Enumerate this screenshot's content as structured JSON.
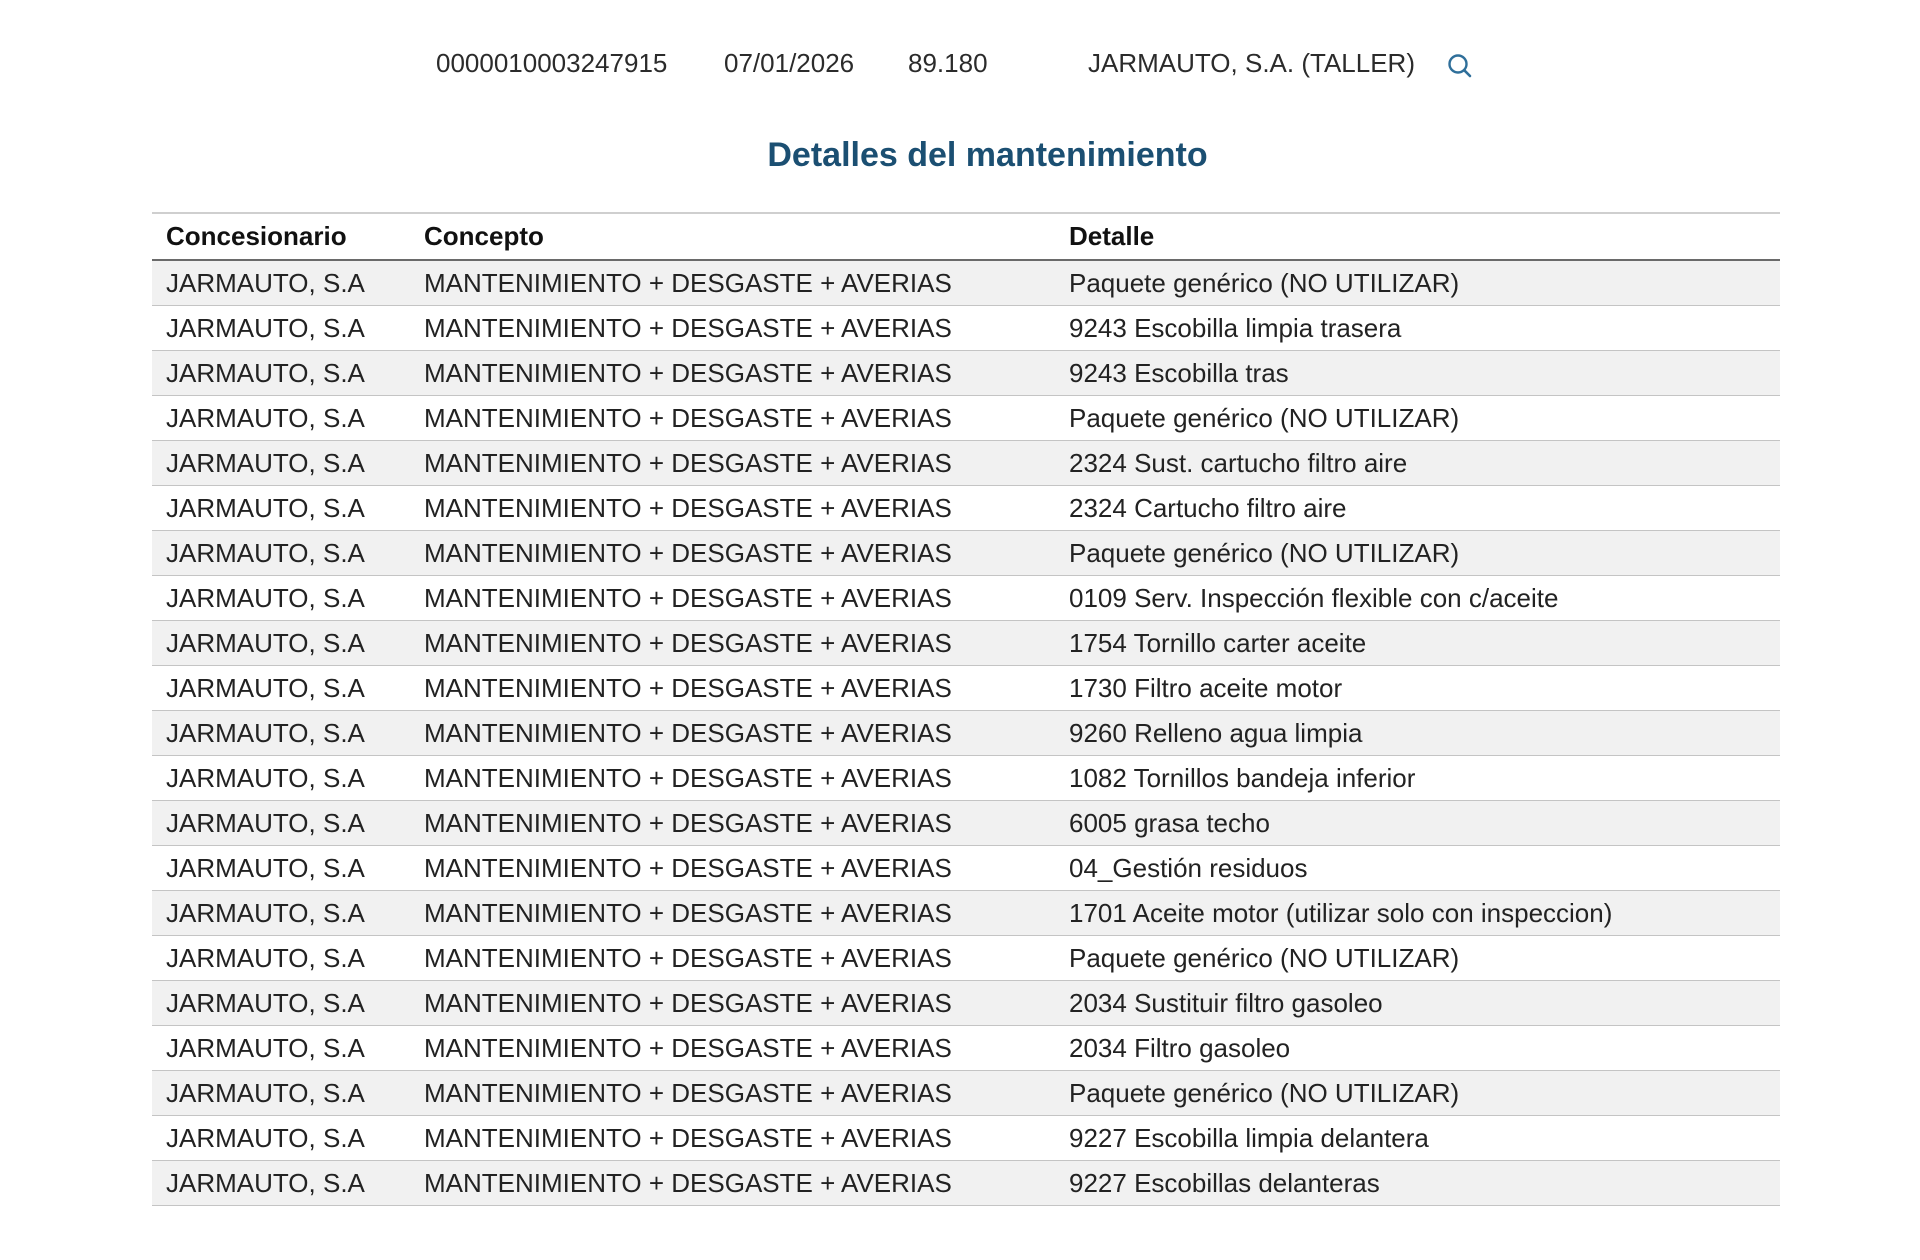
{
  "summary": {
    "id": "0000010003247915",
    "date": "07/01/2026",
    "km": "89.180",
    "dealer": "JARMAUTO, S.A. (TALLER)",
    "search_icon": "search-icon"
  },
  "title": "Detalles del mantenimiento",
  "table": {
    "headers": [
      "Concesionario",
      "Concepto",
      "Detalle"
    ],
    "rows": [
      [
        "JARMAUTO, S.A",
        "MANTENIMIENTO + DESGASTE + AVERIAS",
        "Paquete genérico (NO UTILIZAR)"
      ],
      [
        "JARMAUTO, S.A",
        "MANTENIMIENTO + DESGASTE + AVERIAS",
        "9243 Escobilla limpia trasera"
      ],
      [
        "JARMAUTO, S.A",
        "MANTENIMIENTO + DESGASTE + AVERIAS",
        "9243 Escobilla tras"
      ],
      [
        "JARMAUTO, S.A",
        "MANTENIMIENTO + DESGASTE + AVERIAS",
        "Paquete genérico (NO UTILIZAR)"
      ],
      [
        "JARMAUTO, S.A",
        "MANTENIMIENTO + DESGASTE + AVERIAS",
        "2324 Sust. cartucho filtro aire"
      ],
      [
        "JARMAUTO, S.A",
        "MANTENIMIENTO + DESGASTE + AVERIAS",
        "2324 Cartucho filtro aire"
      ],
      [
        "JARMAUTO, S.A",
        "MANTENIMIENTO + DESGASTE + AVERIAS",
        "Paquete genérico (NO UTILIZAR)"
      ],
      [
        "JARMAUTO, S.A",
        "MANTENIMIENTO + DESGASTE + AVERIAS",
        "0109 Serv. Inspección flexible con c/aceite"
      ],
      [
        "JARMAUTO, S.A",
        "MANTENIMIENTO + DESGASTE + AVERIAS",
        "1754 Tornillo carter aceite"
      ],
      [
        "JARMAUTO, S.A",
        "MANTENIMIENTO + DESGASTE + AVERIAS",
        "1730 Filtro aceite motor"
      ],
      [
        "JARMAUTO, S.A",
        "MANTENIMIENTO + DESGASTE + AVERIAS",
        "9260 Relleno agua limpia"
      ],
      [
        "JARMAUTO, S.A",
        "MANTENIMIENTO + DESGASTE + AVERIAS",
        "1082 Tornillos bandeja inferior"
      ],
      [
        "JARMAUTO, S.A",
        "MANTENIMIENTO + DESGASTE + AVERIAS",
        "6005 grasa techo"
      ],
      [
        "JARMAUTO, S.A",
        "MANTENIMIENTO + DESGASTE + AVERIAS",
        "04_Gestión residuos"
      ],
      [
        "JARMAUTO, S.A",
        "MANTENIMIENTO + DESGASTE + AVERIAS",
        "1701 Aceite motor (utilizar solo con inspeccion)"
      ],
      [
        "JARMAUTO, S.A",
        "MANTENIMIENTO + DESGASTE + AVERIAS",
        "Paquete genérico (NO UTILIZAR)"
      ],
      [
        "JARMAUTO, S.A",
        "MANTENIMIENTO + DESGASTE + AVERIAS",
        "2034 Sustituir filtro gasoleo"
      ],
      [
        "JARMAUTO, S.A",
        "MANTENIMIENTO + DESGASTE + AVERIAS",
        "2034 Filtro gasoleo"
      ],
      [
        "JARMAUTO, S.A",
        "MANTENIMIENTO + DESGASTE + AVERIAS",
        "Paquete genérico (NO UTILIZAR)"
      ],
      [
        "JARMAUTO, S.A",
        "MANTENIMIENTO + DESGASTE + AVERIAS",
        "9227 Escobilla limpia delantera"
      ],
      [
        "JARMAUTO, S.A",
        "MANTENIMIENTO + DESGASTE + AVERIAS",
        "9227 Escobillas delanteras"
      ]
    ]
  },
  "colors": {
    "title": "#1b4f72",
    "icon": "#2f6f9a",
    "stripe": "#f1f1f1"
  }
}
